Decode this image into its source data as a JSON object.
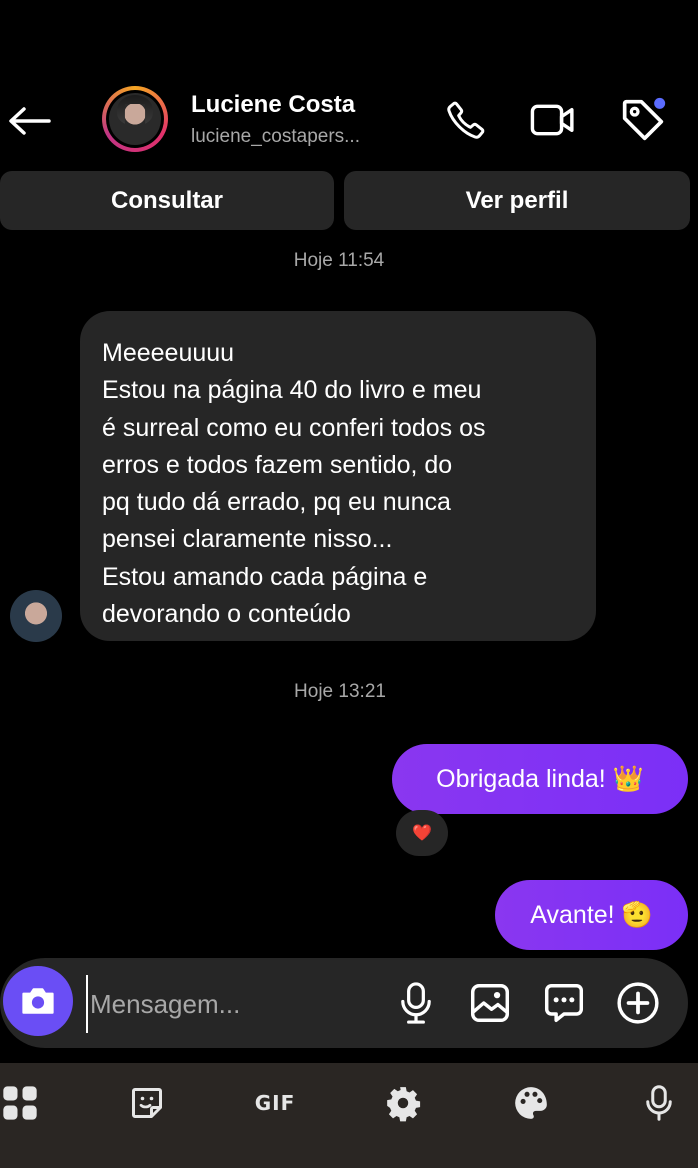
{
  "header": {
    "back_icon": "arrow-left-icon",
    "contact_name": "Luciene Costa",
    "contact_handle": "luciene_costapers...",
    "icons": [
      "phone-icon",
      "video-camera-icon",
      "tag-icon"
    ]
  },
  "actions": {
    "consult_label": "Consultar",
    "profile_label": "Ver perfil"
  },
  "conversation": {
    "timestamp_1": "Hoje 11:54",
    "incoming_message_lines": [
      "Meeeeuuuu",
      "Estou na página 40 do livro e meu",
      "é surreal como eu conferi todos os",
      "erros e todos fazem sentido, do",
      "pq tudo dá errado, pq eu nunca",
      "pensei claramente nisso...",
      "Estou amando cada página e",
      "devorando o conteúdo"
    ],
    "timestamp_2": "Hoje 13:21",
    "outgoing_1": "Obrigada linda! 👑",
    "reaction_1": "❤️",
    "outgoing_2": "Avante! 🫡"
  },
  "composer": {
    "placeholder": "Mensagem...",
    "icons": [
      "camera-icon",
      "microphone-icon",
      "image-icon",
      "chat-bubble-icon",
      "plus-icon"
    ]
  },
  "keyboard_toolbar": {
    "gif_label": "GIF",
    "icons": [
      "apps-grid-icon",
      "sticker-icon",
      "gif-icon",
      "settings-icon",
      "palette-icon",
      "microphone-icon"
    ]
  },
  "colors": {
    "accent_purple": "#7b2ff7",
    "camera_button": "#6a4ef5",
    "bubble_gray": "#262626",
    "notification_dot": "#5b6cff"
  }
}
